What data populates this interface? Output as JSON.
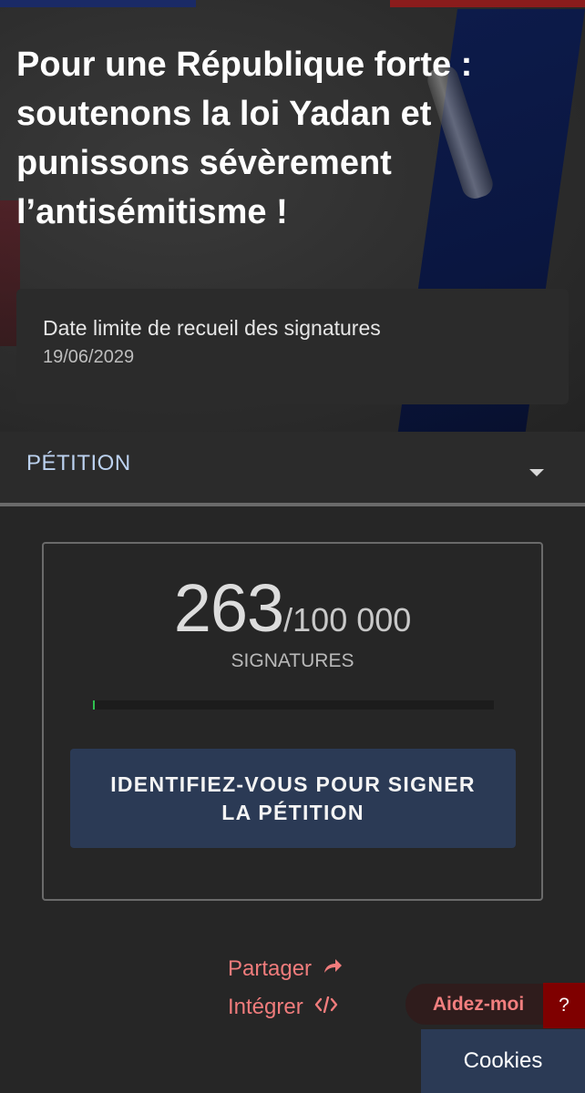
{
  "hero": {
    "title": "Pour une République forte : soutenons la loi Yadan et punissons sévèrement l’antisémitisme !",
    "deadline_label": "Date limite de recueil des signatures",
    "deadline_date": "19/06/2029"
  },
  "section": {
    "label": "PÉTITION",
    "expand_icon": "chevron-down-icon"
  },
  "signatures": {
    "count": "263",
    "goal": "/100 000",
    "label": "SIGNATURES",
    "progress_fraction": 0.00263,
    "button_label": "IDENTIFIEZ-VOUS POUR SIGNER LA PÉTITION"
  },
  "links": {
    "share": "Partager",
    "share_icon": "share-arrow-icon",
    "embed": "Intégrer",
    "embed_icon": "code-icon"
  },
  "help": {
    "label": "Aidez-moi",
    "question_mark": "?"
  },
  "cookies": {
    "label": "Cookies"
  },
  "colors": {
    "background": "#262626",
    "card": "#2b2b2b",
    "button_blue": "#2b3a55",
    "link_red": "#f07c7c",
    "help_dark_red": "#7f0000",
    "progress_green": "#2fbf4f",
    "section_label": "#bcd2f0"
  }
}
